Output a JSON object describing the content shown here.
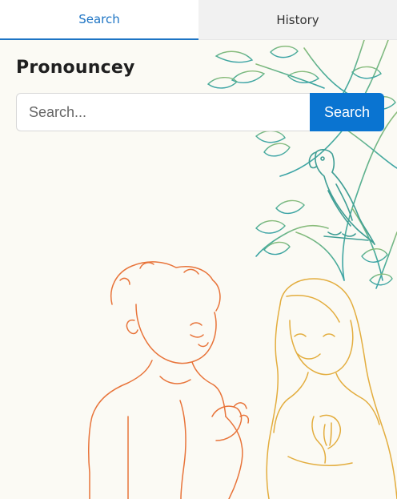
{
  "tabs": [
    {
      "label": "Search",
      "active": true
    },
    {
      "label": "History",
      "active": false
    }
  ],
  "app": {
    "title": "Pronouncey"
  },
  "search": {
    "placeholder": "Search...",
    "value": "",
    "button_label": "Search"
  },
  "colors": {
    "accent": "#0a74d1",
    "tab_active_text": "#1d74c4",
    "background": "#fbfaf4",
    "illustration_boy": "#e8743a",
    "illustration_girl": "#e3ad3e",
    "illustration_tree": "#4fae96"
  }
}
